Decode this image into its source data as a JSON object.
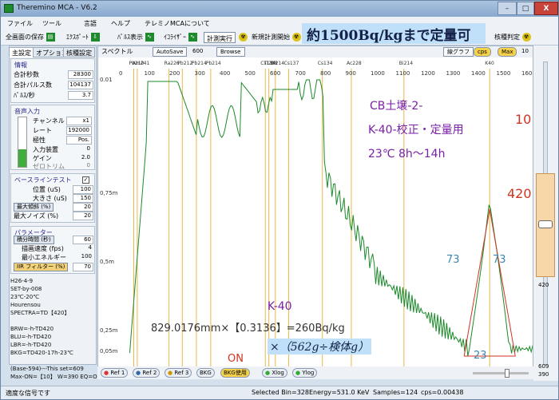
{
  "window": {
    "title": "Theremino MCA - V6.2",
    "minimize": "–",
    "maximize": "□",
    "close": "X"
  },
  "menu": [
    "ファイル",
    "ツール",
    "言語",
    "ヘルプ",
    "テレミノMCAについて"
  ],
  "toolbar": {
    "save_all": "全画面の保存",
    "export": "ｴｸｽﾎﾟｰﾄ",
    "pulse_display": "ﾊﾟﾙｽ表示",
    "equalizer": "ｲｺﾗｲｻﾞｰ",
    "run": "計測実行",
    "new_measure": "新規計測開始",
    "nuclide": "核種判定"
  },
  "banner": "約1500Bq/kgまで定量可",
  "tabs": [
    "主設定",
    "オプション",
    "核種設定"
  ],
  "info": {
    "title": "情報",
    "rows": [
      {
        "label": "合計秒数",
        "value": "28300"
      },
      {
        "label": "合計パルス数",
        "value": "104137"
      },
      {
        "label": "ﾊﾟﾙｽ/秒",
        "value": "3.7"
      }
    ]
  },
  "audio": {
    "title": "音声入力",
    "rows": [
      {
        "label": "チャンネル",
        "value": "x1"
      },
      {
        "label": "レート",
        "value": "192000"
      },
      {
        "label": "極性",
        "value": "Pos."
      },
      {
        "label": "入力装置",
        "value": "0"
      },
      {
        "label": "ゲイン",
        "value": "2.0"
      },
      {
        "label": "ゼロトリム",
        "value": "0"
      }
    ]
  },
  "baseline": {
    "title": "ベースラインテスト",
    "rows": [
      {
        "label": "位置 (uS)",
        "value": "100"
      },
      {
        "label": "大きさ (uS)",
        "value": "150"
      },
      {
        "label": "最大傾斜 (%)",
        "value": "20"
      },
      {
        "label": "最大ノイズ (%)",
        "value": "20"
      }
    ]
  },
  "params": {
    "title": "パラメーター",
    "rows": [
      {
        "label": "積分時間 (秒)",
        "value": "60"
      },
      {
        "label": "描画速度 (fps)",
        "value": "4"
      },
      {
        "label": "最小エネルギー",
        "value": "100"
      },
      {
        "label": "IIR フィルター (%)",
        "value": "70"
      }
    ]
  },
  "notes": "H26-4-9\nSET-by-008\n23℃-20℃\nHourensou\nSPECTRA=TD【420】\n\nBRW=-h-TD420\nBLU=-h-TD420\nLBR=-h-TD420\nBKG=TD420-17h-23℃\n\n(Base-594)---This set=609\nMax-ON=【10】 W=390 EQ=ON",
  "graph": {
    "spectrum_label": "スペクトル",
    "autosave": "AutoSave",
    "autosave_value": "600",
    "browse": "Browse",
    "linear": "線グラフ",
    "cps": "cps",
    "max": "Max",
    "top_value": "10",
    "y_ticks": [
      "0.01",
      "0,75m",
      "0,5m",
      "0,25m",
      "0,05m"
    ],
    "x_ticks": [
      "0",
      "100",
      "200",
      "300",
      "400",
      "500",
      "600",
      "700",
      "800",
      "900",
      "1000",
      "1100",
      "1200",
      "1300",
      "1400",
      "1500",
      "1600"
    ],
    "nuclides": [
      "Pb210",
      "Am241",
      "Ra226",
      "Pb212",
      "Pb214",
      "Pb214",
      "Cs134",
      "Cs137",
      "Cs134",
      "Tl208",
      "Ac228",
      "Bi214",
      "Bi214",
      "K40",
      "Bi214"
    ],
    "annotations": {
      "title1": "CB土壌-2-",
      "title2": "K-40-校正・定量用",
      "title3": "23℃  8h～14h",
      "num10": "10",
      "num420": "420",
      "k40": "K-40",
      "formula": "829.0176mm×【0.3136】=260Bq/kg",
      "formula2": "×（562g÷検体g）",
      "on": "ON",
      "left73": "73",
      "right73": "73",
      "base23": "23"
    }
  },
  "right": {
    "v1": "420",
    "v2": "609",
    "v3": "390"
  },
  "bottom": [
    "Ref 1",
    "Ref 2",
    "Ref 3",
    "BKG",
    "BKG使用",
    "Xlog",
    "Ylog"
  ],
  "status": {
    "left": "適度な信号です",
    "bin": "Selected Bin=328",
    "energy": "Energy=531.0 KeV",
    "samples": "Samples=124",
    "cps": "cps=0.00438"
  },
  "colors": {
    "spectrum": "#1b8a2a",
    "nuclide_lines": "#e8b84a",
    "annotation_purple": "#7a1fa8",
    "annotation_red": "#d0331f",
    "annotation_blue": "#3a85b5"
  }
}
